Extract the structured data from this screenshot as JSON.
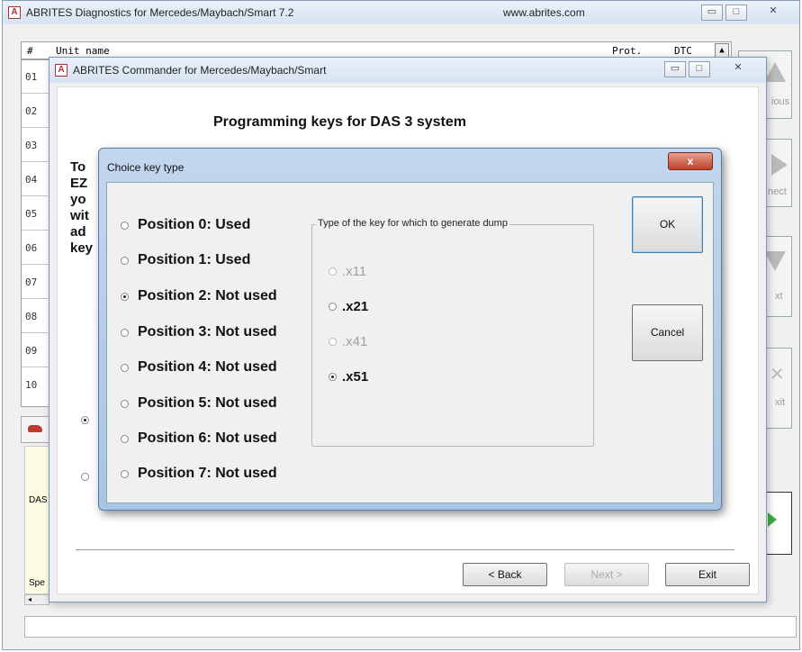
{
  "main_window": {
    "title": "ABRITES Diagnostics for Mercedes/Maybach/Smart 7.2",
    "url": "www.abrites.com",
    "grid_header_hash": "#",
    "grid_header_unit": "Unit name",
    "grid_header_prot": "Prot.",
    "grid_header_dtc": "DTC",
    "rows": [
      "01",
      "02",
      "03",
      "04",
      "05",
      "06",
      "07",
      "08",
      "09",
      "10"
    ],
    "side_buttons": [
      "ious",
      "nect",
      "xt",
      "xit"
    ],
    "left_labels": {
      "das": "DAS",
      "spe": "Spe"
    }
  },
  "commander": {
    "title": "ABRITES Commander for Mercedes/Maybach/Smart",
    "heading": "Programming keys for DAS 3 system",
    "body_lines": [
      "To",
      "EZ",
      "yo",
      "wit",
      "ad",
      "key"
    ],
    "back": "< Back",
    "next": "Next >",
    "exit": "Exit"
  },
  "dialog": {
    "title": "Choice key type",
    "close": "x",
    "positions": [
      {
        "label": "Position 0: Used",
        "selected": false
      },
      {
        "label": "Position 1: Used",
        "selected": false
      },
      {
        "label": "Position 2: Not used",
        "selected": true
      },
      {
        "label": "Position 3: Not used",
        "selected": false
      },
      {
        "label": "Position 4: Not used",
        "selected": false
      },
      {
        "label": "Position 5: Not used",
        "selected": false
      },
      {
        "label": "Position 6: Not used",
        "selected": false
      },
      {
        "label": "Position 7: Not used",
        "selected": false
      }
    ],
    "group_label": "Type of the key for which to generate dump",
    "key_types": [
      {
        "label": ".x11",
        "enabled": false,
        "selected": false
      },
      {
        "label": ".x21",
        "enabled": true,
        "selected": false
      },
      {
        "label": ".x41",
        "enabled": false,
        "selected": false
      },
      {
        "label": ".x51",
        "enabled": true,
        "selected": true
      }
    ],
    "ok": "OK",
    "cancel": "Cancel"
  }
}
